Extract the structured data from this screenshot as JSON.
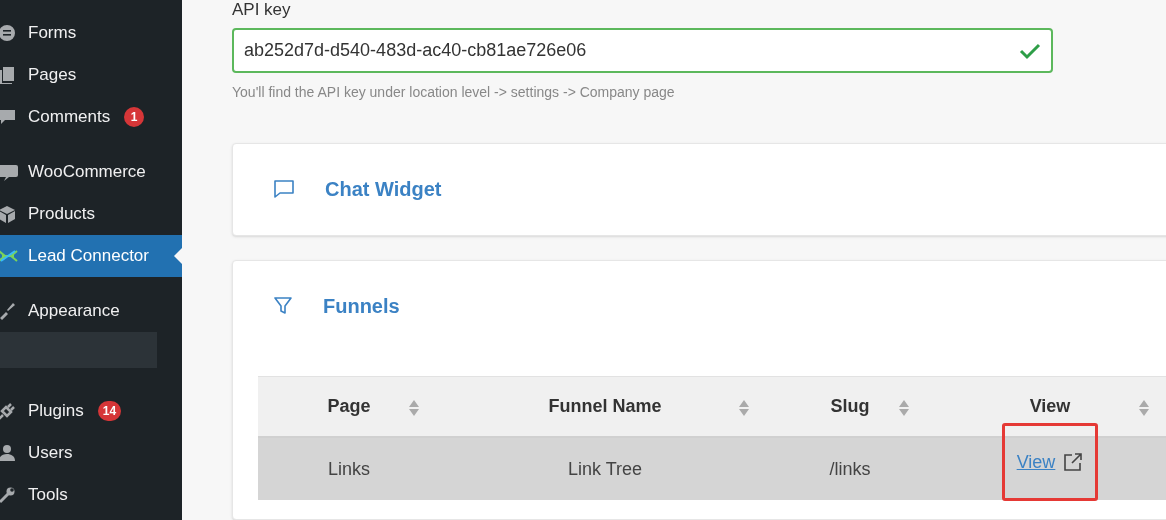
{
  "sidebar": {
    "groups": [
      {
        "items": [
          {
            "label": "Forms",
            "selected": false
          },
          {
            "label": "Pages",
            "selected": false
          },
          {
            "label": "Comments",
            "badge": "1",
            "selected": false
          }
        ]
      },
      {
        "items": [
          {
            "label": "WooCommerce",
            "selected": false
          },
          {
            "label": "Products",
            "selected": false
          },
          {
            "label": "Lead Connector",
            "selected": true
          }
        ]
      },
      {
        "items": [
          {
            "label": "Appearance",
            "selected": false
          }
        ]
      },
      {
        "items": [
          {
            "label": "Plugins",
            "badge": "14",
            "selected": false
          },
          {
            "label": "Users",
            "selected": false
          },
          {
            "label": "Tools",
            "selected": false
          }
        ]
      }
    ]
  },
  "api_key": {
    "label": "API key",
    "value": "ab252d7d-d540-483d-ac40-cb81ae726e06",
    "valid": true,
    "help": "You'll find the API key under location level -> settings -> Company page"
  },
  "cards": [
    {
      "title": "Chat Widget"
    },
    {
      "title": "Funnels"
    }
  ],
  "table": {
    "columns": [
      "Page",
      "Funnel Name",
      "Slug",
      "View"
    ],
    "rows": [
      {
        "page": "Links",
        "funnel_name": "Link Tree",
        "slug": "/links",
        "view": "View",
        "highlighted": true
      }
    ]
  }
}
